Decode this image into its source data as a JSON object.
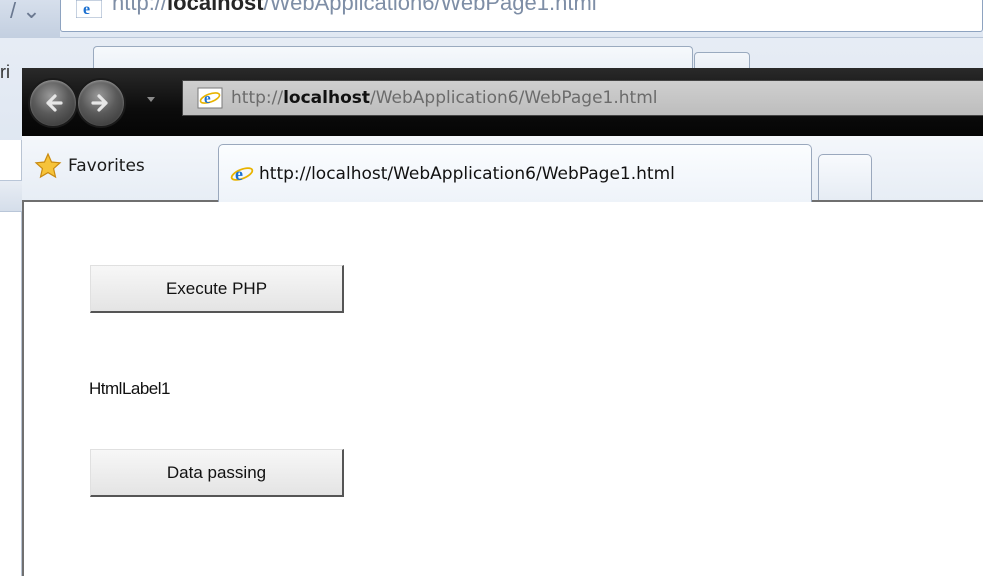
{
  "background_window": {
    "url_prefix": "http://",
    "url_host": "localhost",
    "url_path": "/WebApplication6/WebPage1.html",
    "favorites_fragment": "ri"
  },
  "browser": {
    "address_bar": {
      "url_prefix": "http://",
      "url_host": "localhost",
      "url_path": "/WebApplication6/WebPage1.html"
    },
    "favorites_label": "Favorites",
    "active_tab_title": "http://localhost/WebApplication6/WebPage1.html",
    "icons": {
      "back": "back-arrow-icon",
      "forward": "forward-arrow-icon",
      "dropdown": "chevron-down-icon",
      "favorites": "star-icon",
      "page": "ie-logo-icon"
    }
  },
  "page": {
    "execute_button_label": "Execute PHP",
    "html_label_text": "HtmlLabel1",
    "data_button_label": "Data passing"
  },
  "colors": {
    "toolbar": "#0c0c0c",
    "tabbar": "#eef3f9",
    "url_host": "#111111",
    "url_dim": "#6b6b6b"
  }
}
